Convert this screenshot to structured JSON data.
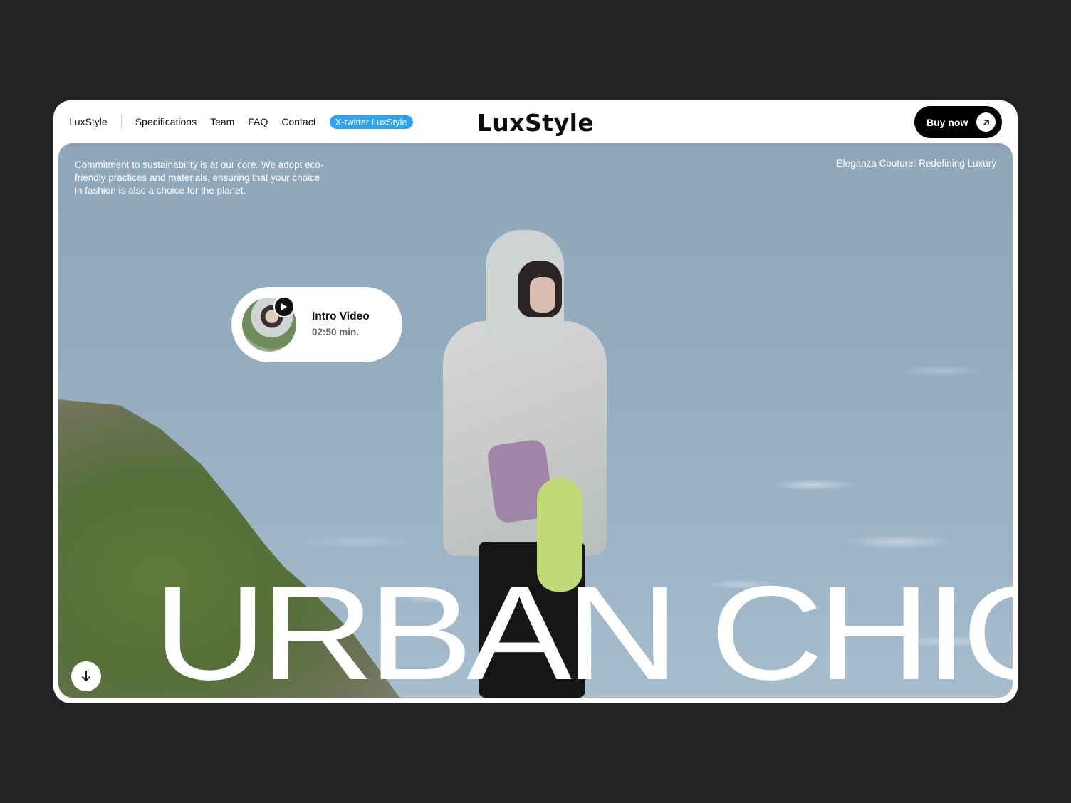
{
  "nav": {
    "brand": "LuxStyle",
    "links": [
      {
        "label": "Specifications"
      },
      {
        "label": "Team"
      },
      {
        "label": "FAQ"
      },
      {
        "label": "Contact"
      }
    ],
    "social_pill": "X-twitter LuxStyle",
    "logo": "LuxStyle",
    "buy_label": "Buy now",
    "buy_icon": "arrow-up-right-icon"
  },
  "hero": {
    "description": "Commitment to sustainability is at our core. We adopt eco-friendly practices and materials, ensuring that your choice in fashion is also a choice for the planet.",
    "tagline": "Eleganza Couture: Redefining Luxury",
    "video": {
      "title": "Intro Video",
      "duration": "02:50 min.",
      "play_icon": "play-icon"
    },
    "headline": "URBAN CHIC",
    "scroll_icon": "arrow-down-icon"
  },
  "colors": {
    "background": "#232323",
    "pill": "#2aa3f0",
    "button": "#000000"
  }
}
